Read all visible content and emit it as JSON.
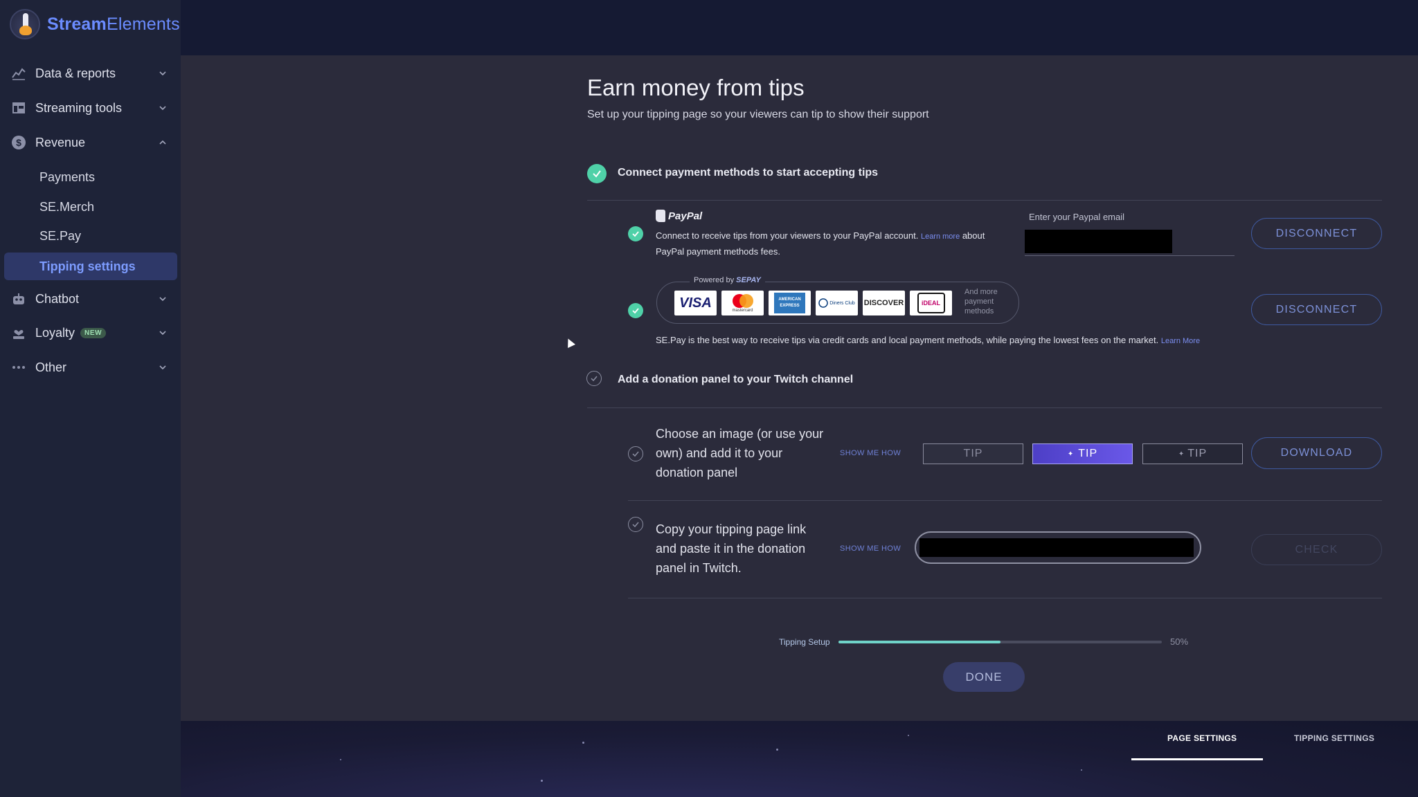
{
  "brand": {
    "name_part1": "Stream",
    "name_part2": "Elements"
  },
  "sidebar": {
    "items": [
      {
        "label": "Data & reports",
        "icon": "chart-icon",
        "expanded": false
      },
      {
        "label": "Streaming tools",
        "icon": "layout-icon",
        "expanded": false
      },
      {
        "label": "Revenue",
        "icon": "dollar-icon",
        "expanded": true
      },
      {
        "label": "Chatbot",
        "icon": "robot-icon",
        "expanded": false
      },
      {
        "label": "Loyalty",
        "icon": "heart-hand-icon",
        "badge": "NEW",
        "expanded": false
      },
      {
        "label": "Other",
        "icon": "more-dots-icon",
        "expanded": false
      }
    ],
    "revenue_sub": [
      "Payments",
      "SE.Merch",
      "SE.Pay",
      "Tipping settings"
    ],
    "active_sub": "Tipping settings"
  },
  "main": {
    "title": "Earn money from tips",
    "subtitle": "Set up your tipping page so your viewers can tip to show their support",
    "step1": {
      "title": "Connect payment methods to start accepting tips",
      "done": true,
      "paypal": {
        "brand": "PayPal",
        "desc_before": "Connect to receive tips from your viewers to your PayPal account. ",
        "learn_more": "Learn more",
        "desc_after": " about PayPal payment methods fees.",
        "email_label": "Enter your Paypal email",
        "disconnect": "DISCONNECT"
      },
      "sepay": {
        "powered_by": "Powered by",
        "powered_brand": "SEPAY",
        "cards": [
          "VISA",
          "mastercard",
          "AMERICAN EXPRESS",
          "Diners Club",
          "DISCOVER",
          "iDEAL"
        ],
        "more_methods": "And more payment methods",
        "desc": "SE.Pay is the best way to receive tips via credit cards and local payment methods, while paying the lowest fees on the market.",
        "learn_more": "Learn More",
        "disconnect": "DISCONNECT"
      }
    },
    "step2": {
      "title": "Add a donation panel to your Twitch channel",
      "done": false,
      "image_step": {
        "text": "Choose an image (or use your own) and add it to your donation panel",
        "show_me": "SHOW ME HOW",
        "tip_label": "TIP",
        "download": "DOWNLOAD"
      },
      "link_step": {
        "text": "Copy your tipping page link and paste it in the donation panel in Twitch.",
        "show_me": "SHOW ME HOW",
        "check": "CHECK"
      }
    },
    "progress": {
      "label": "Tipping Setup",
      "value": 0.5,
      "percent_text": "50%"
    },
    "done_button": "DONE"
  },
  "footer": {
    "tabs": [
      "PAGE SETTINGS",
      "TIPPING SETTINGS"
    ],
    "active_tab": "PAGE SETTINGS"
  },
  "colors": {
    "accent": "#6b8cff",
    "success": "#4fd1a8",
    "progress": "#6fd3c8",
    "sidebar_bg": "#1e2338",
    "main_bg": "#2b2b3b"
  }
}
